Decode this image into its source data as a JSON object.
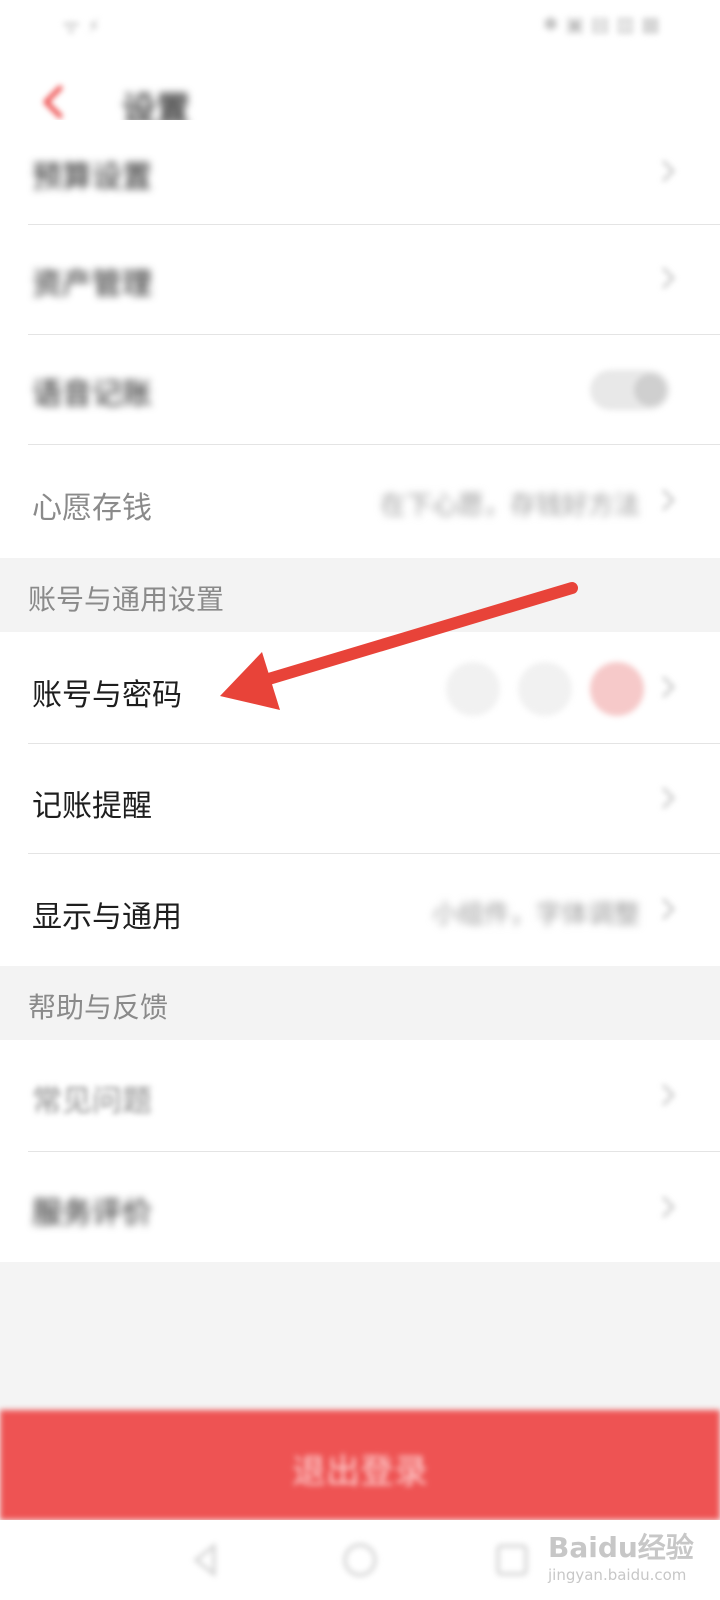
{
  "status_bar": {
    "left": "ᯤ ⚡",
    "right": "✱ ▣ ▤ ▥ ▦"
  },
  "header": {
    "title": "设置"
  },
  "rows_top": [
    {
      "label": "预算设置",
      "value": ""
    },
    {
      "label": "资产管理",
      "value": ""
    },
    {
      "label": "语音记账",
      "value": ""
    },
    {
      "label": "心愿存钱",
      "value": "在下心愿，存钱好方法"
    }
  ],
  "sections": {
    "account": {
      "title": "账号与通用设置",
      "rows": [
        {
          "label": "账号与密码",
          "value": ""
        },
        {
          "label": "记账提醒",
          "value": ""
        },
        {
          "label": "显示与通用",
          "value": "小组件，字体调整"
        }
      ]
    },
    "help": {
      "title": "帮助与反馈",
      "rows": [
        {
          "label": "常见问题",
          "value": ""
        },
        {
          "label": "服务评价",
          "value": ""
        }
      ]
    }
  },
  "logout": {
    "label": "退出登录"
  },
  "watermark": {
    "brand": "Baidu经验",
    "url": "jingyan.baidu.com"
  },
  "colors": {
    "accent": "#ee5353",
    "arrow": "#e84339"
  }
}
